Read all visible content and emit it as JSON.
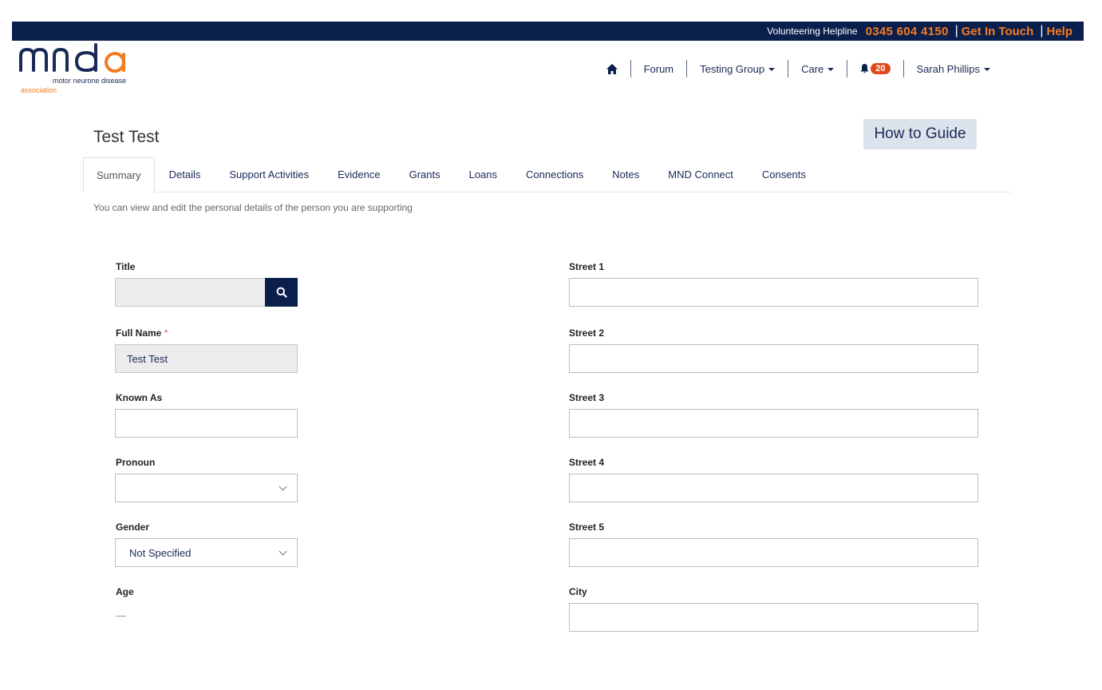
{
  "topbar": {
    "helpline_label": "Volunteering Helpline",
    "phone": "0345 604 4150",
    "get_in_touch": "Get In Touch",
    "help": "Help"
  },
  "logo": {
    "line1": "motor neurone disease",
    "line2": "association"
  },
  "nav": {
    "home_icon": "home-icon",
    "forum": "Forum",
    "testing_group": "Testing Group",
    "care": "Care",
    "bell_icon": "bell-icon",
    "notification_count": "20",
    "user": "Sarah Phillips"
  },
  "page": {
    "title": "Test Test",
    "how_to_guide": "How to Guide",
    "subtitle": "You can view and edit the personal details of the person you are supporting"
  },
  "tabs": [
    "Summary",
    "Details",
    "Support Activities",
    "Evidence",
    "Grants",
    "Loans",
    "Connections",
    "Notes",
    "MND Connect",
    "Consents"
  ],
  "active_tab": "Summary",
  "form": {
    "title_label": "Title",
    "title_value": "",
    "full_name_label": "Full Name",
    "required_mark": "*",
    "full_name_value": "Test Test",
    "known_as_label": "Known As",
    "known_as_value": "",
    "pronoun_label": "Pronoun",
    "pronoun_value": "",
    "gender_label": "Gender",
    "gender_value": "Not Specified",
    "age_label": "Age",
    "age_value": "—",
    "street1_label": "Street 1",
    "street2_label": "Street 2",
    "street3_label": "Street 3",
    "street4_label": "Street 4",
    "street5_label": "Street 5",
    "city_label": "City"
  },
  "colors": {
    "navy": "#0b1f4d",
    "orange": "#f47b20",
    "badge": "#e04b1e"
  }
}
